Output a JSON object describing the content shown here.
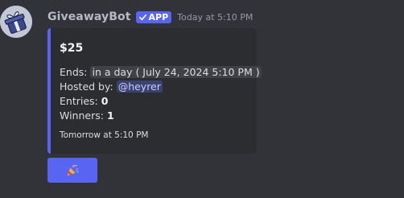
{
  "message": {
    "author": "GiveawayBot",
    "app_tag": "APP",
    "timestamp": "Today at 5:10 PM"
  },
  "embed": {
    "title": "$25",
    "ends_label": "Ends:",
    "ends_relative": "in a day",
    "ends_absolute": "( July 24, 2024 5:10 PM )",
    "hosted_label": "Hosted by:",
    "host": "@heyrer",
    "entries_label": "Entries:",
    "entries": "0",
    "winners_label": "Winners:",
    "winners": "1",
    "footer": "Tomorrow at 5:10 PM",
    "accent_color": "#5865f2"
  },
  "button": {
    "icon": "party-popper-icon",
    "color": "#5865f2"
  }
}
